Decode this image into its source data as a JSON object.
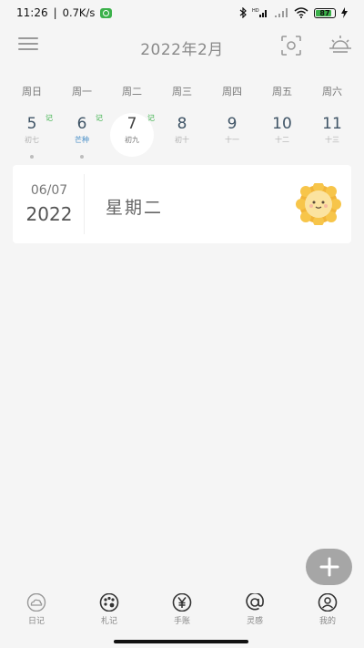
{
  "status_bar": {
    "time": "11:26",
    "net_speed": "0.7K/s",
    "battery_level": "87",
    "accent": "#3bb14a"
  },
  "header": {
    "month_title": "2022年2月",
    "menu_icon": "menu-icon",
    "scan_icon": "scan-icon",
    "weather_icon": "sunrise-icon"
  },
  "weekdays": [
    "周日",
    "周一",
    "周二",
    "周三",
    "周四",
    "周五",
    "周六"
  ],
  "dates": [
    {
      "num": "5",
      "lunar": "初七",
      "has_record": true,
      "record_label": "记"
    },
    {
      "num": "6",
      "lunar": "芒种",
      "has_record": true,
      "record_label": "记"
    },
    {
      "num": "7",
      "lunar": "初九",
      "has_record": true,
      "record_label": "记",
      "selected": true
    },
    {
      "num": "8",
      "lunar": "初十",
      "has_record": false
    },
    {
      "num": "9",
      "lunar": "十一",
      "has_record": false
    },
    {
      "num": "10",
      "lunar": "十二",
      "has_record": false
    },
    {
      "num": "11",
      "lunar": "十三",
      "has_record": false
    }
  ],
  "entry_card": {
    "month_day": "06/07",
    "year": "2022",
    "weekday": "星期二",
    "mood_icon": "sun-face-icon"
  },
  "fab": {
    "icon": "plus-icon"
  },
  "bottom_nav": {
    "items": [
      {
        "label": "日记",
        "icon": "cloud-icon"
      },
      {
        "label": "札记",
        "icon": "palette-icon"
      },
      {
        "label": "手账",
        "icon": "yen-icon"
      },
      {
        "label": "灵感",
        "icon": "at-icon"
      },
      {
        "label": "我的",
        "icon": "user-icon"
      }
    ]
  }
}
